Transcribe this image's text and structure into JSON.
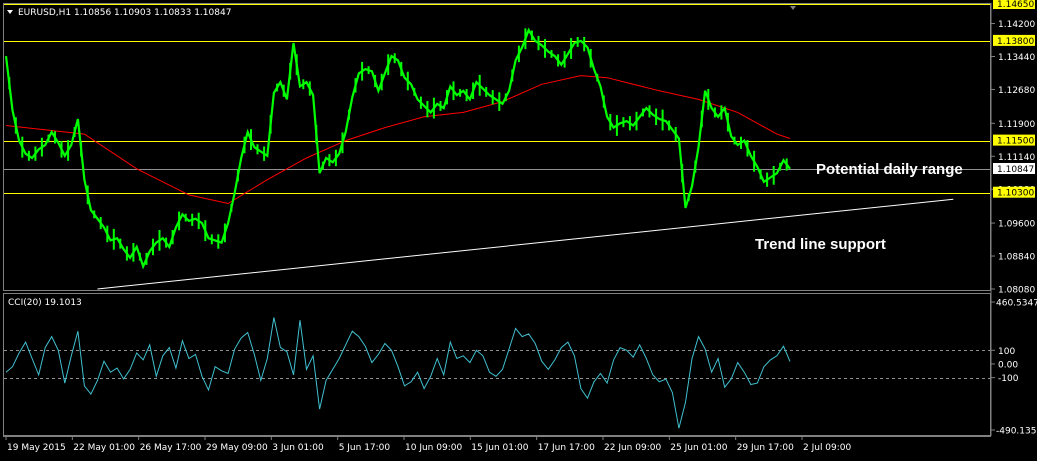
{
  "colors": {
    "background": "#000000",
    "candles": "#00ff00",
    "moving_average": "#ff0000",
    "level_lines": "#ffff00",
    "current_price_line": "#c0c0c0",
    "trend_line": "#ffffff",
    "cci": "#40c0d0",
    "price_tag_bg": "#ffff00"
  },
  "header": {
    "symbol_line": "EURUSD,H1  1.10856 1.10903 1.10833 1.10847",
    "cci_line": "CCI(20) 19.1013"
  },
  "chart_data": [
    {
      "type": "line",
      "title": "EURUSD,H1",
      "ylim": [
        1.0808,
        1.1465
      ],
      "price_scale_ticks": [
        "1.14650",
        "1.14200",
        "1.13440",
        "1.12680",
        "1.11900",
        "1.11140",
        "1.10380",
        "1.09600",
        "1.08840",
        "1.08080"
      ],
      "levels": [
        {
          "value": 1.1465,
          "label": "1.14650"
        },
        {
          "value": 1.138,
          "label": "1.13800"
        },
        {
          "value": 1.115,
          "label": "1.11500"
        },
        {
          "value": 1.103,
          "label": "1.10300"
        }
      ],
      "current_price": {
        "value": 1.10847,
        "label": "1.10847"
      },
      "x_labels": [
        "19 May 2015",
        "22 May 01:00",
        "26 May 17:00",
        "29 May 09:00",
        "3 Jun 01:00",
        "5 Jun 17:00",
        "10 Jun 09:00",
        "15 Jun 01:00",
        "17 Jun 17:00",
        "22 Jun 09:00",
        "25 Jun 01:00",
        "29 Jun 17:00",
        "2 Jul 09:00"
      ],
      "price_path": [
        [
          0,
          1.1345
        ],
        [
          1,
          1.122
        ],
        [
          2,
          1.115
        ],
        [
          3,
          1.112
        ],
        [
          4,
          1.111
        ],
        [
          5,
          1.113
        ],
        [
          6,
          1.114
        ],
        [
          7,
          1.117
        ],
        [
          8,
          1.1145
        ],
        [
          9,
          1.1115
        ],
        [
          10,
          1.114
        ],
        [
          11,
          1.12
        ],
        [
          12,
          1.106
        ],
        [
          13,
          1.099
        ],
        [
          14,
          1.097
        ],
        [
          15,
          1.095
        ],
        [
          16,
          1.092
        ],
        [
          17,
          1.0925
        ],
        [
          18,
          1.09
        ],
        [
          19,
          1.088
        ],
        [
          20,
          1.0905
        ],
        [
          21,
          1.086
        ],
        [
          22,
          1.0895
        ],
        [
          23,
          1.0915
        ],
        [
          24,
          1.0925
        ],
        [
          25,
          1.0905
        ],
        [
          26,
          1.095
        ],
        [
          27,
          1.098
        ],
        [
          28,
          1.0965
        ],
        [
          29,
          1.097
        ],
        [
          30,
          1.096
        ],
        [
          31,
          1.0925
        ],
        [
          32,
          1.092
        ],
        [
          33,
          1.0915
        ],
        [
          34,
          1.096
        ],
        [
          35,
          1.103
        ],
        [
          36,
          1.111
        ],
        [
          37,
          1.117
        ],
        [
          38,
          1.1135
        ],
        [
          39,
          1.1125
        ],
        [
          40,
          1.1115
        ],
        [
          41,
          1.126
        ],
        [
          42,
          1.1285
        ],
        [
          43,
          1.1245
        ],
        [
          44,
          1.1375
        ],
        [
          45,
          1.1275
        ],
        [
          46,
          1.1285
        ],
        [
          47,
          1.1255
        ],
        [
          48,
          1.1075
        ],
        [
          49,
          1.111
        ],
        [
          50,
          1.11
        ],
        [
          51,
          1.112
        ],
        [
          52,
          1.117
        ],
        [
          53,
          1.125
        ],
        [
          54,
          1.1305
        ],
        [
          55,
          1.1315
        ],
        [
          56,
          1.131
        ],
        [
          57,
          1.1265
        ],
        [
          58,
          1.1305
        ],
        [
          59,
          1.1345
        ],
        [
          60,
          1.1335
        ],
        [
          61,
          1.1295
        ],
        [
          62,
          1.128
        ],
        [
          63,
          1.1245
        ],
        [
          64,
          1.123
        ],
        [
          65,
          1.1215
        ],
        [
          66,
          1.1235
        ],
        [
          67,
          1.1225
        ],
        [
          68,
          1.1275
        ],
        [
          69,
          1.1255
        ],
        [
          70,
          1.1265
        ],
        [
          71,
          1.1245
        ],
        [
          72,
          1.1285
        ],
        [
          73,
          1.127
        ],
        [
          74,
          1.1255
        ],
        [
          75,
          1.1245
        ],
        [
          76,
          1.1235
        ],
        [
          77,
          1.1265
        ],
        [
          78,
          1.1335
        ],
        [
          79,
          1.1365
        ],
        [
          80,
          1.1405
        ],
        [
          81,
          1.138
        ],
        [
          82,
          1.137
        ],
        [
          83,
          1.1355
        ],
        [
          84,
          1.1345
        ],
        [
          85,
          1.1325
        ],
        [
          86,
          1.135
        ],
        [
          87,
          1.1375
        ],
        [
          88,
          1.138
        ],
        [
          89,
          1.1365
        ],
        [
          90,
          1.1315
        ],
        [
          91,
          1.1275
        ],
        [
          92,
          1.1205
        ],
        [
          93,
          1.118
        ],
        [
          94,
          1.119
        ],
        [
          95,
          1.1195
        ],
        [
          96,
          1.1185
        ],
        [
          97,
          1.1205
        ],
        [
          98,
          1.1225
        ],
        [
          99,
          1.121
        ],
        [
          100,
          1.12
        ],
        [
          101,
          1.1195
        ],
        [
          102,
          1.1175
        ],
        [
          103,
          1.1155
        ],
        [
          104,
          1.0995
        ],
        [
          105,
          1.1045
        ],
        [
          106,
          1.1135
        ],
        [
          107,
          1.1265
        ],
        [
          108,
          1.1225
        ],
        [
          109,
          1.1205
        ],
        [
          110,
          1.1225
        ],
        [
          111,
          1.116
        ],
        [
          112,
          1.114
        ],
        [
          113,
          1.115
        ],
        [
          114,
          1.1115
        ],
        [
          115,
          1.109
        ],
        [
          116,
          1.1055
        ],
        [
          117,
          1.1065
        ],
        [
          118,
          1.1075
        ],
        [
          119,
          1.1105
        ],
        [
          120,
          1.1085
        ]
      ],
      "moving_average_path": [
        [
          0,
          1.1185
        ],
        [
          12,
          1.1165
        ],
        [
          20,
          1.1085
        ],
        [
          28,
          1.1025
        ],
        [
          34,
          1.1005
        ],
        [
          40,
          1.106
        ],
        [
          46,
          1.111
        ],
        [
          52,
          1.115
        ],
        [
          58,
          1.118
        ],
        [
          64,
          1.1205
        ],
        [
          70,
          1.1215
        ],
        [
          76,
          1.124
        ],
        [
          82,
          1.128
        ],
        [
          88,
          1.13
        ],
        [
          92,
          1.1295
        ],
        [
          100,
          1.1265
        ],
        [
          106,
          1.1245
        ],
        [
          112,
          1.1215
        ],
        [
          118,
          1.1165
        ],
        [
          120,
          1.1155
        ]
      ],
      "trend_line": [
        [
          14,
          1.0808
        ],
        [
          145,
          1.1015
        ]
      ],
      "annotations": [
        {
          "text": "Potential daily range"
        },
        {
          "text": "Trend line support"
        }
      ]
    },
    {
      "type": "line",
      "title": "CCI(20) 19.1013",
      "ylim": [
        -490.1353,
        460.5347
      ],
      "scale_labels": [
        "460.5347",
        "100",
        "0.00",
        "-100",
        "-490.1353"
      ],
      "levels": [
        100,
        -100
      ],
      "series": [
        {
          "name": "CCI(20)",
          "values": [
            -60,
            -20,
            80,
            160,
            40,
            -80,
            120,
            200,
            100,
            -140,
            60,
            240,
            -160,
            -220,
            -120,
            20,
            -60,
            -30,
            -110,
            -40,
            80,
            30,
            140,
            -90,
            60,
            120,
            -30,
            170,
            40,
            70,
            -90,
            -190,
            -20,
            -50,
            -70,
            110,
            190,
            230,
            70,
            -120,
            40,
            340,
            120,
            90,
            -80,
            320,
            -40,
            60,
            -330,
            -120,
            -40,
            40,
            140,
            240,
            200,
            130,
            10,
            70,
            150,
            100,
            -20,
            -160,
            -130,
            -60,
            -180,
            -90,
            40,
            -80,
            160,
            40,
            60,
            10,
            100,
            60,
            -60,
            -90,
            -40,
            110,
            260,
            200,
            220,
            150,
            20,
            -40,
            30,
            120,
            160,
            60,
            -180,
            -250,
            -130,
            -70,
            -140,
            30,
            120,
            100,
            50,
            140,
            40,
            -80,
            -130,
            -110,
            -210,
            -470,
            -280,
            40,
            200,
            110,
            -60,
            40,
            -170,
            -110,
            10,
            -60,
            -150,
            -140,
            -20,
            30,
            60,
            130,
            19.1
          ]
        }
      ]
    }
  ]
}
